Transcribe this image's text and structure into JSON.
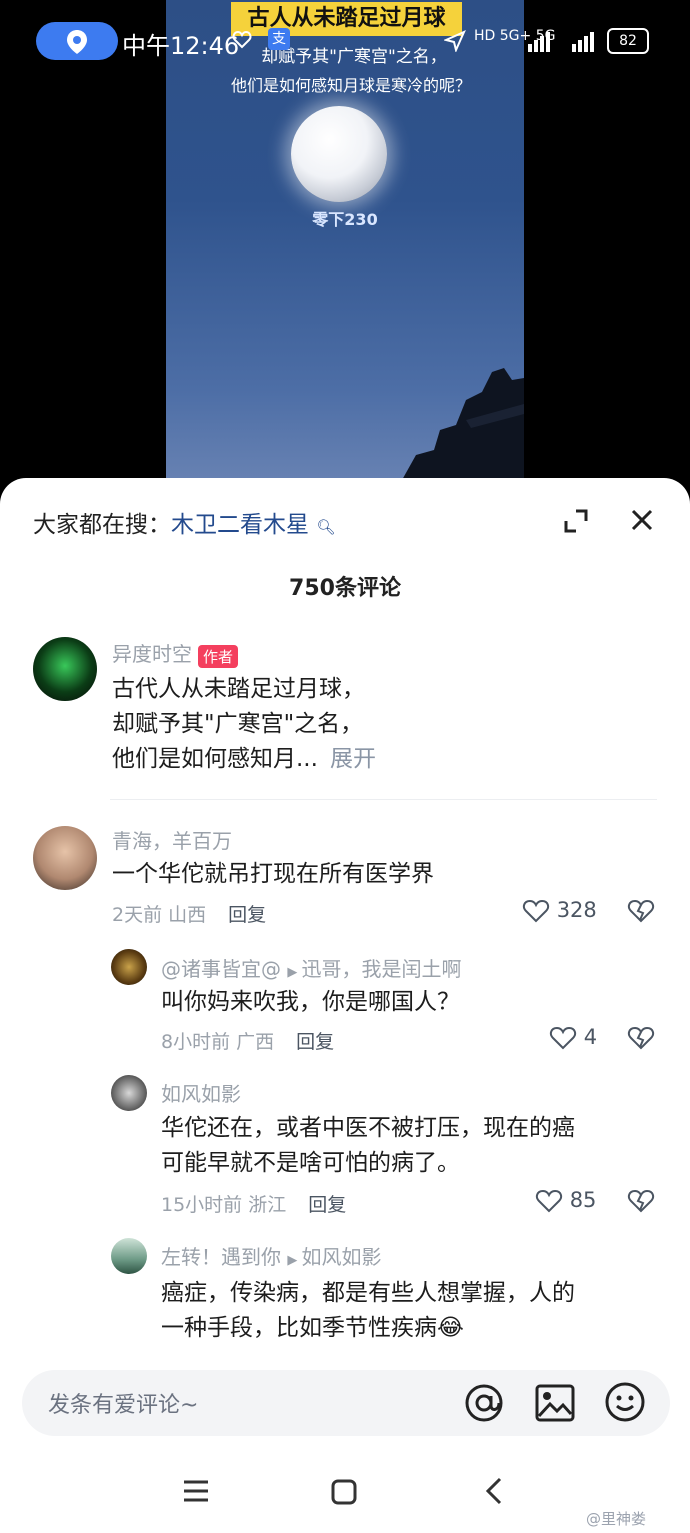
{
  "video": {
    "headline": "古人从未踏足过月球",
    "subtitle_line1": "却赋予其\"广寒宫\"之名，",
    "subtitle_line2": "他们是如何感知月球是寒冷的呢？",
    "moon_label": "零下230"
  },
  "status_bar": {
    "time": "中午12:46",
    "network": "HD 5G+ 5G",
    "battery": "82"
  },
  "sheet": {
    "search_prefix": "大家都在搜：",
    "search_term": "木卫二看木星",
    "comment_count": "750条评论"
  },
  "comments": [
    {
      "user": "异度时空",
      "tag": "作者",
      "lines": [
        "古代人从未踏足过月球，",
        "却赋予其\"广寒宫\"之名，",
        "他们是如何感知月..."
      ],
      "expand": "展开"
    },
    {
      "user": "青海，羊百万",
      "text": "一个华佗就吊打现在所有医学界",
      "time_loc": "2天前 山西",
      "reply": "回复",
      "likes": "328"
    }
  ],
  "replies": [
    {
      "user": "@诸事皆宜@",
      "reply_to": "迅哥，我是闰土啊",
      "text": "叫你妈来吹我，你是哪国人？",
      "time_loc": "8小时前 广西",
      "reply": "回复",
      "likes": "4"
    },
    {
      "user": "如风如影",
      "lines": [
        "华佗还在，或者中医不被打压，现在的癌",
        "可能早就不是啥可怕的病了。"
      ],
      "time_loc": "15小时前 浙江",
      "reply": "回复",
      "likes": "85"
    },
    {
      "user": "左转！遇到你",
      "reply_to": "如风如影",
      "lines": [
        "癌症，传染病，都是有些人想掌握，人的",
        "一种手段，比如季节性疾病😂"
      ]
    }
  ],
  "input": {
    "placeholder": "发条有爱评论~"
  },
  "watermark": "@里神娄",
  "colors": {
    "accent_blue": "#3d7bf0",
    "headline_yellow": "#f5d23b",
    "author_tag": "#f43f5e"
  }
}
